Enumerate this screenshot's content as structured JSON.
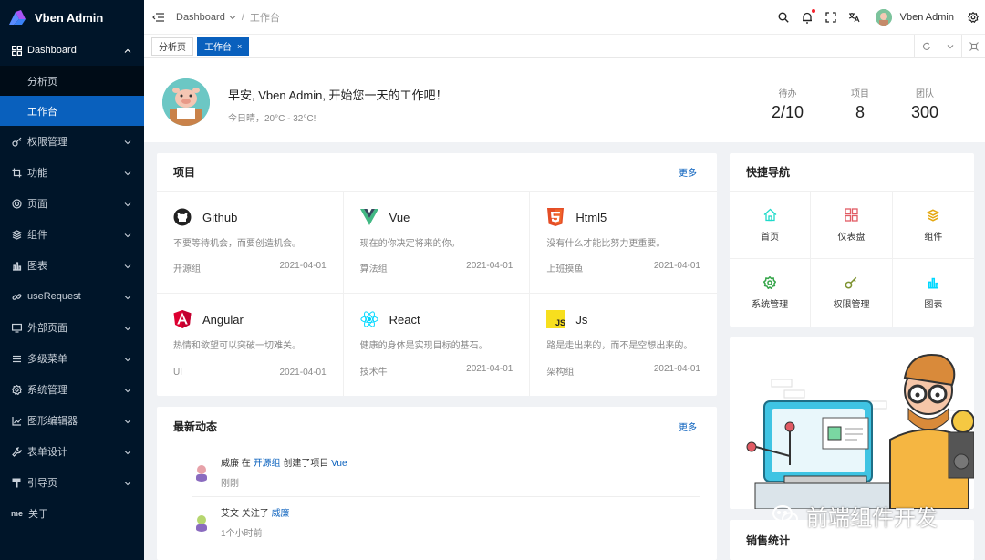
{
  "app": {
    "title": "Vben Admin"
  },
  "sidebar": {
    "items": [
      {
        "label": "Dashboard",
        "icon": "grid-icon",
        "open": true
      },
      {
        "label": "权限管理",
        "icon": "key-icon"
      },
      {
        "label": "功能",
        "icon": "crop-icon"
      },
      {
        "label": "页面",
        "icon": "page-icon"
      },
      {
        "label": "组件",
        "icon": "layers-icon"
      },
      {
        "label": "图表",
        "icon": "chart-icon"
      },
      {
        "label": "useRequest",
        "icon": "link-icon"
      },
      {
        "label": "外部页面",
        "icon": "monitor-icon"
      },
      {
        "label": "多级菜单",
        "icon": "list-icon"
      },
      {
        "label": "系统管理",
        "icon": "settings-icon"
      },
      {
        "label": "图形编辑器",
        "icon": "editor-icon"
      },
      {
        "label": "表单设计",
        "icon": "wrench-icon"
      },
      {
        "label": "引导页",
        "icon": "paint-roller-icon"
      },
      {
        "label": "关于",
        "icon": "about-icon",
        "prefix": "me"
      }
    ],
    "dashboard_children": [
      {
        "label": "分析页"
      },
      {
        "label": "工作台",
        "active": true
      }
    ]
  },
  "header": {
    "breadcrumb": [
      "Dashboard",
      "工作台"
    ],
    "user": "Vben Admin"
  },
  "tabs": [
    {
      "label": "分析页"
    },
    {
      "label": "工作台",
      "active": true,
      "close": "×"
    }
  ],
  "banner": {
    "greeting": "早安, Vben Admin, 开始您一天的工作吧！",
    "weather": "今日晴，20°C - 32°C!",
    "stats": [
      {
        "label": "待办",
        "value": "2/10"
      },
      {
        "label": "项目",
        "value": "8"
      },
      {
        "label": "团队",
        "value": "300"
      }
    ]
  },
  "projects": {
    "title": "项目",
    "more": "更多",
    "items": [
      {
        "name": "Github",
        "icon": "github-icon",
        "desc": "不要等待机会，而要创造机会。",
        "group": "开源组",
        "date": "2021-04-01"
      },
      {
        "name": "Vue",
        "icon": "vue-icon",
        "desc": "现在的你决定将来的你。",
        "group": "算法组",
        "date": "2021-04-01"
      },
      {
        "name": "Html5",
        "icon": "html5-icon",
        "desc": "没有什么才能比努力更重要。",
        "group": "上班摸鱼",
        "date": "2021-04-01"
      },
      {
        "name": "Angular",
        "icon": "angular-icon",
        "desc": "热情和欲望可以突破一切难关。",
        "group": "UI",
        "date": "2021-04-01"
      },
      {
        "name": "React",
        "icon": "react-icon",
        "desc": "健康的身体是实现目标的基石。",
        "group": "技术牛",
        "date": "2021-04-01"
      },
      {
        "name": "Js",
        "icon": "js-icon",
        "desc": "路是走出来的，而不是空想出来的。",
        "group": "架构组",
        "date": "2021-04-01"
      }
    ]
  },
  "activity": {
    "title": "最新动态",
    "more": "更多",
    "items": [
      {
        "user": "威廉",
        "mid1": " 在 ",
        "link1": "开源组",
        "mid2": " 创建了项目 ",
        "link2": "Vue",
        "time": "刚刚"
      },
      {
        "user": "艾文",
        "mid1": " 关注了 ",
        "link1": "威廉",
        "mid2": "",
        "link2": "",
        "time": "1个小时前"
      }
    ]
  },
  "quicknav": {
    "title": "快捷导航",
    "items": [
      {
        "label": "首页",
        "icon": "home-icon",
        "color": "#1fdaca"
      },
      {
        "label": "仪表盘",
        "icon": "dashboard-icon",
        "color": "#e15b64"
      },
      {
        "label": "组件",
        "icon": "layers-icon",
        "color": "#e4a70f"
      },
      {
        "label": "系统管理",
        "icon": "settings-icon",
        "color": "#37a64b"
      },
      {
        "label": "权限管理",
        "icon": "key-icon",
        "color": "#7e9330"
      },
      {
        "label": "图表",
        "icon": "chart-icon",
        "color": "#00d8ff"
      }
    ]
  },
  "sales": {
    "title": "销售统计"
  },
  "watermark": {
    "text": "前端组件开发"
  },
  "colors": {
    "primary": "#0960bd",
    "sidebar": "#001529"
  }
}
